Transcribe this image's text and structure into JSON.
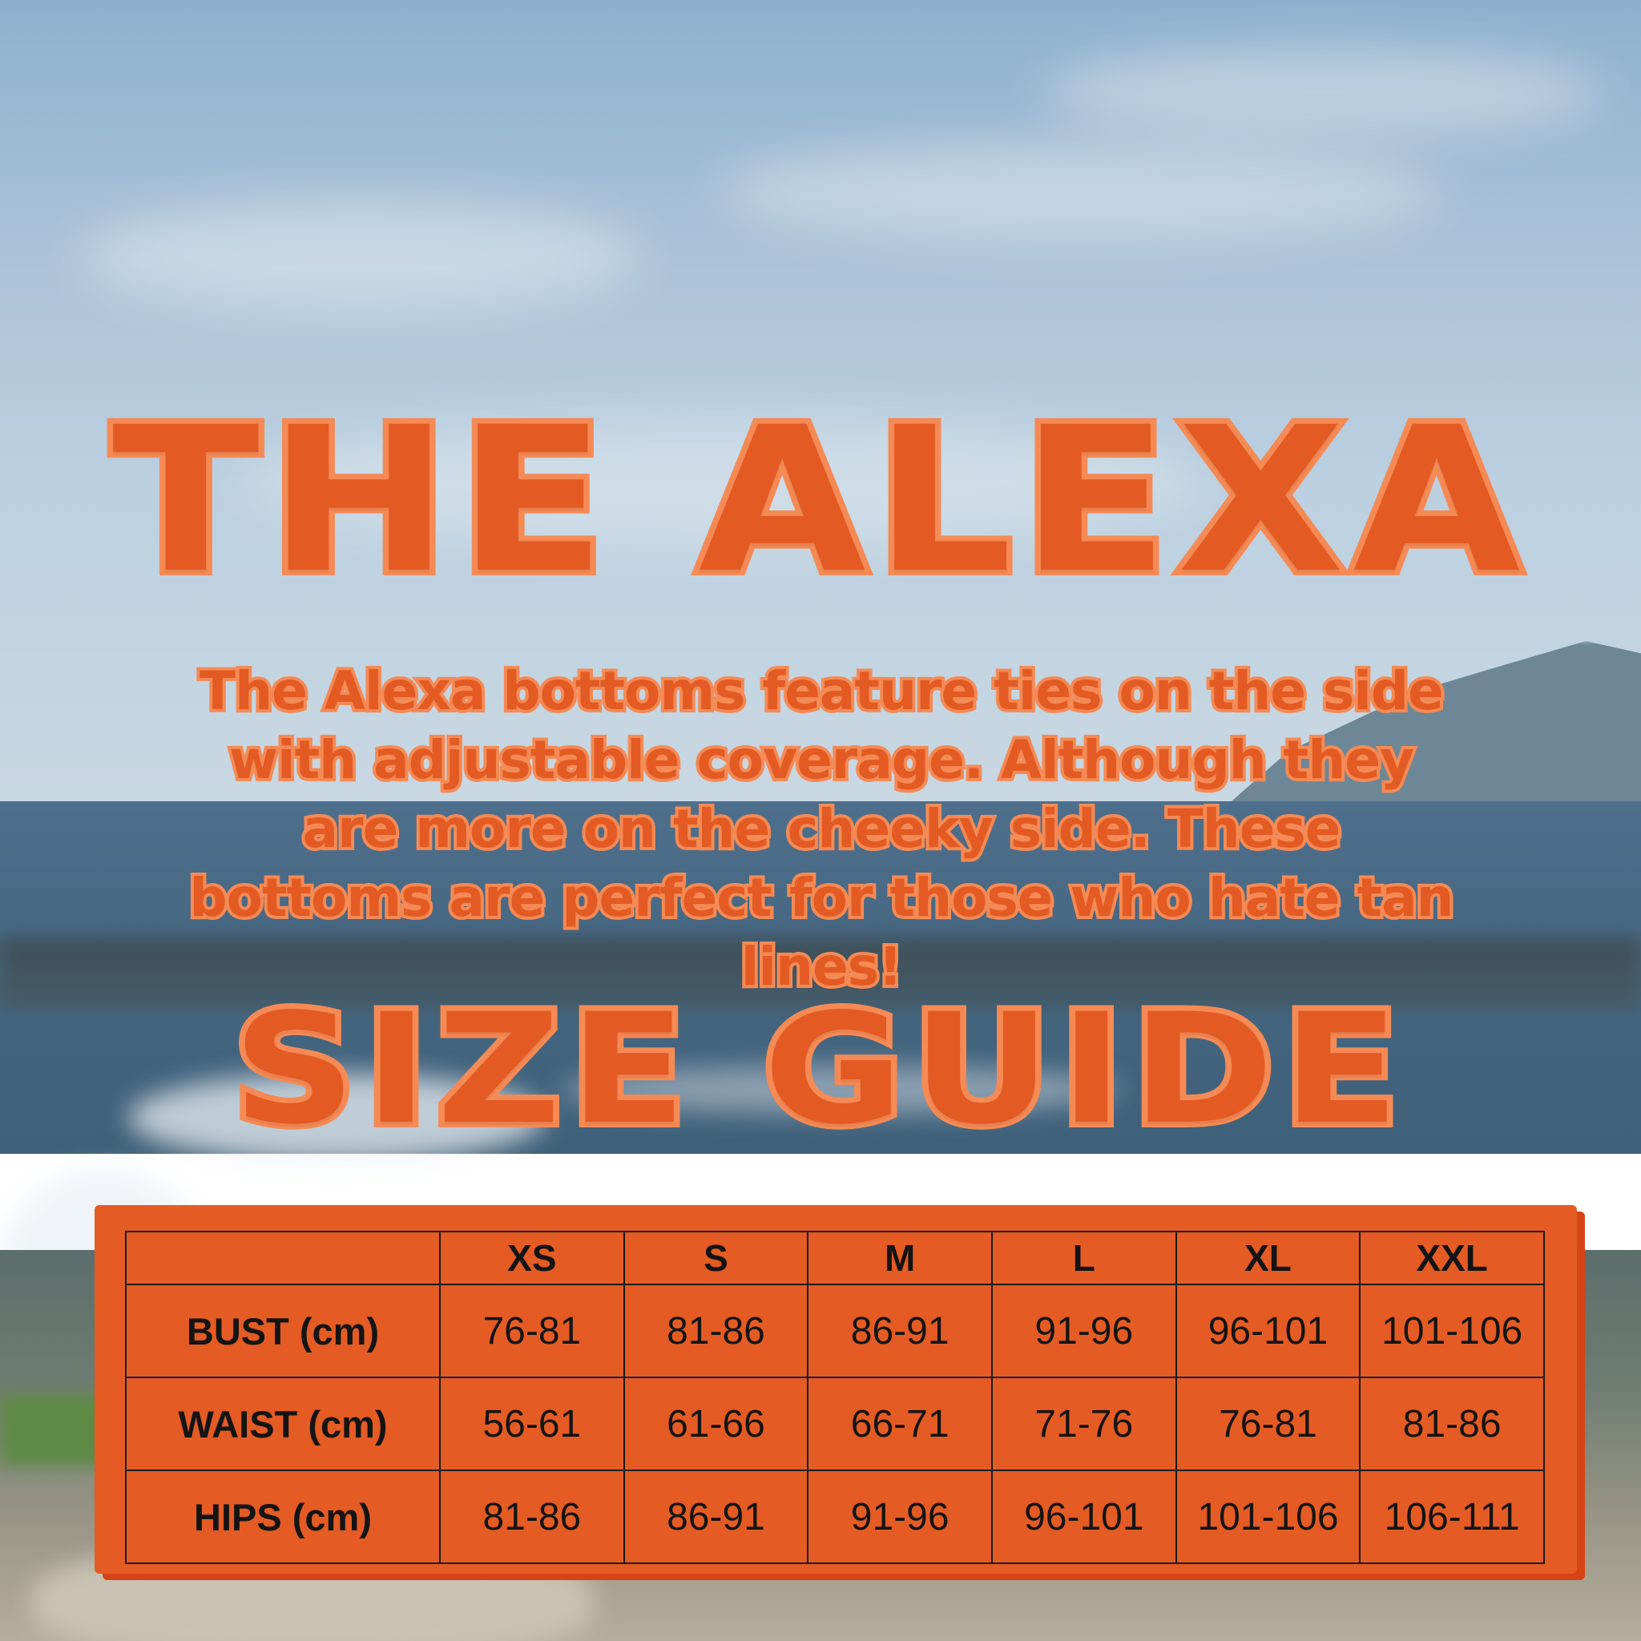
{
  "title": "THE ALEXA",
  "description": "The Alexa bottoms feature ties on the side with adjustable coverage. Although they are more on the cheeky side. These bottoms are perfect for those who hate tan lines!",
  "size_guide_title": "SIZE GUIDE",
  "colors": {
    "accent": "#e35a23",
    "outline": "#f58a55",
    "table_bg": "#e45b24"
  },
  "table": {
    "headers": [
      "",
      "XS",
      "S",
      "M",
      "L",
      "XL",
      "XXL"
    ],
    "rows": [
      {
        "label": "BUST (cm)",
        "values": [
          "76-81",
          "81-86",
          "86-91",
          "91-96",
          "96-101",
          "101-106"
        ]
      },
      {
        "label": "WAIST (cm)",
        "values": [
          "56-61",
          "61-66",
          "66-71",
          "71-76",
          "76-81",
          "81-86"
        ]
      },
      {
        "label": "HIPS (cm)",
        "values": [
          "81-86",
          "86-91",
          "91-96",
          "96-101",
          "101-106",
          "106-111"
        ]
      }
    ]
  }
}
